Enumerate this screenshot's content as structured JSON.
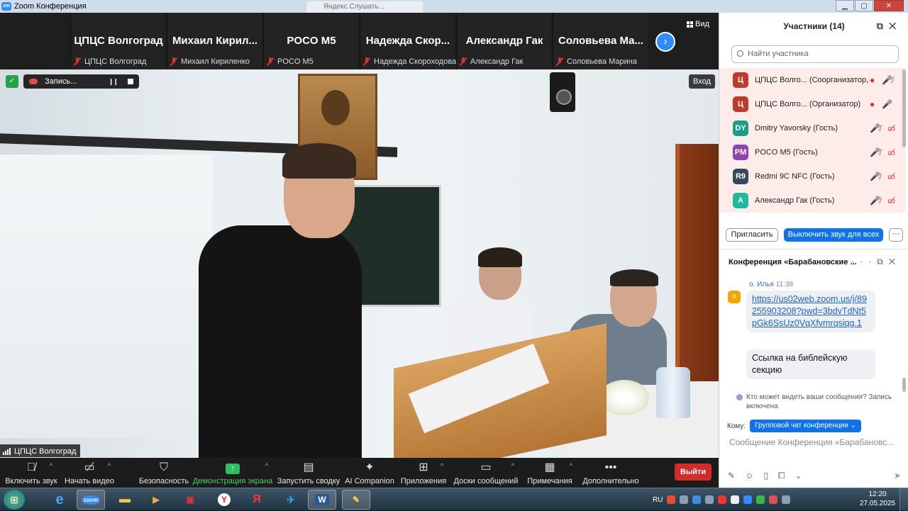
{
  "window": {
    "title": "Zoom Конференция",
    "bg_tab_text": "Яндекс.Слушать...",
    "buttons": [
      "minimize",
      "maximize",
      "close"
    ]
  },
  "top_strip": {
    "tiles": [
      {
        "name": "ЦПЦС Волгоград",
        "sub": "ЦПЦС Волгоград"
      },
      {
        "name": "Михаил  Кирил...",
        "sub": "Михаил Кириленко"
      },
      {
        "name": "POCO M5",
        "sub": "POCO M5"
      },
      {
        "name": "Надежда  Скор...",
        "sub": "Надежда Скороходова"
      },
      {
        "name": "Александр Гак",
        "sub": "Александр Гак"
      },
      {
        "name": "Соловьева  Ма...",
        "sub": "Соловьева Марина"
      }
    ],
    "view_label": "Вид",
    "next_icon": "chevron-right"
  },
  "main_video": {
    "recording_label": "Запись...",
    "enter_label": "Вход",
    "speaker_name": "ЦПЦС Волгоград"
  },
  "toolbar": {
    "items": [
      {
        "label": "Включить звук",
        "icon": "mic-muted"
      },
      {
        "label": "Начать видео",
        "icon": "video-off"
      },
      {
        "label": "Безопасность",
        "icon": "shield"
      },
      {
        "label": "Демонстрация экрана",
        "icon": "share-screen"
      },
      {
        "label": "Запустить сводку",
        "icon": "summary"
      },
      {
        "label": "AI Companion",
        "icon": "sparkle"
      },
      {
        "label": "Приложения",
        "icon": "apps"
      },
      {
        "label": "Доски сообщений",
        "icon": "whiteboard"
      },
      {
        "label": "Примечания",
        "icon": "notes"
      },
      {
        "label": "Дополнительно",
        "icon": "more"
      }
    ],
    "leave_label": "Выйти"
  },
  "participants": {
    "title": "Участники (14)",
    "search_placeholder": "Найти участника",
    "list": [
      {
        "initials": "Ц",
        "name": "ЦПЦС Волго... (Соорганизатор, я)",
        "color": "#c0392b"
      },
      {
        "initials": "Ц",
        "name": "ЦПЦС Волго... (Организатор)",
        "color": "#c0392b"
      },
      {
        "initials": "DY",
        "name": "Dmitry Yavorsky (Гость)",
        "color": "#16a085"
      },
      {
        "initials": "PM",
        "name": "POCO M5 (Гость)",
        "color": "#8e44ad"
      },
      {
        "initials": "R9",
        "name": "Redmi 9C NFC (Гость)",
        "color": "#34495e"
      },
      {
        "initials": "А",
        "name": "Александр Гак (Гость)",
        "color": "#1abc9c"
      }
    ],
    "invite_label": "Пригласить",
    "unmute_all_label": "Выключить звук для всех",
    "more_label": "···"
  },
  "chat": {
    "title": "Конференция «Барабановские ...",
    "sender": "о. Илья",
    "sender_initial": "о",
    "time": "11:38",
    "link_message": "https://us02web.zoom.us/j/89255903208?pwd=3bdvTdNt5pGk6SsUz0VqXfvmrqsiqg.1",
    "text_message": "Ссылка на библейскую секцию",
    "notice": "Кто может видеть ваши сообщения? Запись включена",
    "to_label": "Кому:",
    "to_value": "Групповой чат конференции",
    "input_placeholder": "Сообщение Конференция «Барабановс..."
  },
  "taskbar": {
    "apps": [
      "IE",
      "zoom",
      "folder",
      "media",
      "save",
      "yandex-browser",
      "yandex",
      "telegram",
      "word",
      "paint"
    ],
    "lang": "RU",
    "time": "12:20",
    "date": "27.05.2025"
  },
  "colors": {
    "accent": "#0e72ed",
    "danger": "#d42a2a",
    "share_green": "#2fbf5f"
  }
}
